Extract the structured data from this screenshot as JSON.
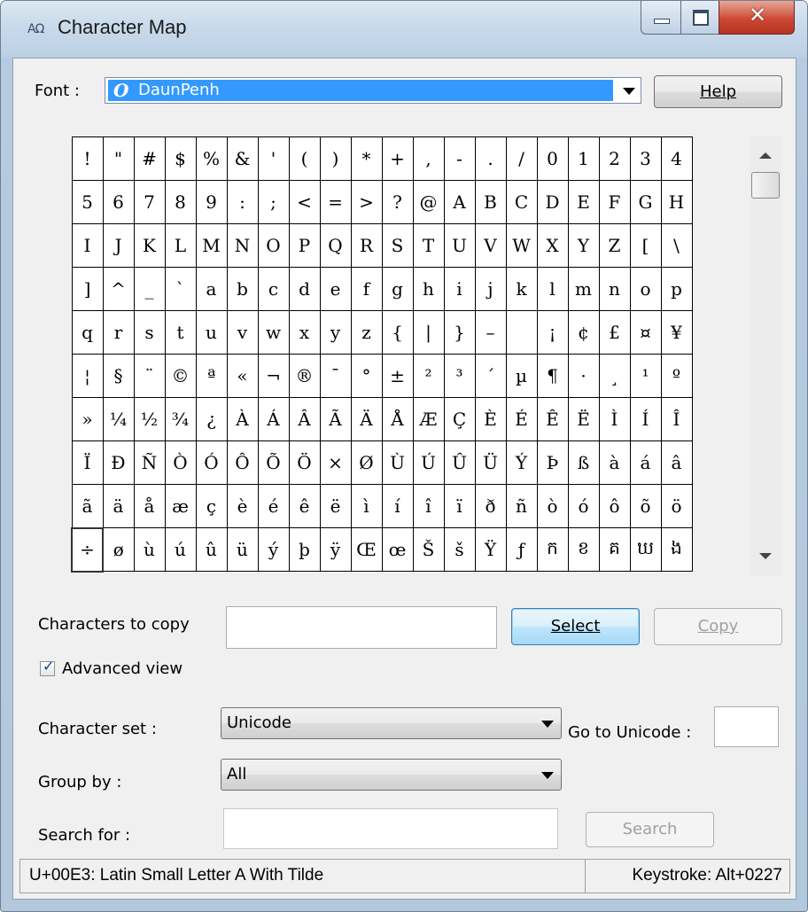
{
  "window": {
    "title": "Character Map"
  },
  "font": {
    "label": "Font :",
    "value": "DaunPenh",
    "icon": "opentype-font-icon"
  },
  "help_button": "Help",
  "characters": [
    [
      "!",
      "\"",
      "#",
      "$",
      "%",
      "&",
      "'",
      "(",
      ")",
      "*",
      "+",
      ",",
      "-",
      ".",
      "/",
      "0",
      "1",
      "2",
      "3",
      "4"
    ],
    [
      "5",
      "6",
      "7",
      "8",
      "9",
      ":",
      ";",
      "<",
      "=",
      ">",
      "?",
      "@",
      "A",
      "B",
      "C",
      "D",
      "E",
      "F",
      "G",
      "H"
    ],
    [
      "I",
      "J",
      "K",
      "L",
      "M",
      "N",
      "O",
      "P",
      "Q",
      "R",
      "S",
      "T",
      "U",
      "V",
      "W",
      "X",
      "Y",
      "Z",
      "[",
      "\\"
    ],
    [
      "]",
      "^",
      "_",
      "`",
      "a",
      "b",
      "c",
      "d",
      "e",
      "f",
      "g",
      "h",
      "i",
      "j",
      "k",
      "l",
      "m",
      "n",
      "o",
      "p"
    ],
    [
      "q",
      "r",
      "s",
      "t",
      "u",
      "v",
      "w",
      "x",
      "y",
      "z",
      "{",
      "|",
      "}",
      "–",
      "",
      "¡",
      "¢",
      "£",
      "¤",
      "¥"
    ],
    [
      "¦",
      "§",
      "¨",
      "©",
      "ª",
      "«",
      "¬",
      "®",
      "¯",
      "°",
      "±",
      "²",
      "³",
      "´",
      "µ",
      "¶",
      "·",
      "¸",
      "¹",
      "º"
    ],
    [
      "»",
      "¼",
      "½",
      "¾",
      "¿",
      "À",
      "Á",
      "Â",
      "Ã",
      "Ä",
      "Å",
      "Æ",
      "Ç",
      "È",
      "É",
      "Ê",
      "Ë",
      "Ì",
      "Í",
      "Î"
    ],
    [
      "Ï",
      "Ð",
      "Ñ",
      "Ò",
      "Ó",
      "Ô",
      "Õ",
      "Ö",
      "×",
      "Ø",
      "Ù",
      "Ú",
      "Û",
      "Ü",
      "Ý",
      "Þ",
      "ß",
      "à",
      "á",
      "â"
    ],
    [
      "ã",
      "ä",
      "å",
      "æ",
      "ç",
      "è",
      "é",
      "ê",
      "ë",
      "ì",
      "í",
      "î",
      "ï",
      "ð",
      "ñ",
      "ò",
      "ó",
      "ô",
      "õ",
      "ö"
    ],
    [
      "÷",
      "ø",
      "ù",
      "ú",
      "û",
      "ü",
      "ý",
      "þ",
      "ÿ",
      "Œ",
      "œ",
      "Š",
      "š",
      "Ÿ",
      "ƒ",
      "ក",
      "ខ",
      "គ",
      "ឃ",
      "ង"
    ]
  ],
  "copy_row": {
    "label": "Characters to copy",
    "value": "",
    "select_button": "Select",
    "copy_button": "Copy"
  },
  "advanced_view": {
    "label": "Advanced view",
    "checked": true
  },
  "character_set": {
    "label": "Character set :",
    "value": "Unicode"
  },
  "goto_unicode": {
    "label": "Go to Unicode :",
    "value": ""
  },
  "group_by": {
    "label": "Group by :",
    "value": "All"
  },
  "search": {
    "label": "Search for :",
    "value": "",
    "button": "Search"
  },
  "status": {
    "description": "U+00E3: Latin Small Letter A With Tilde",
    "keystroke": "Keystroke: Alt+0227"
  }
}
